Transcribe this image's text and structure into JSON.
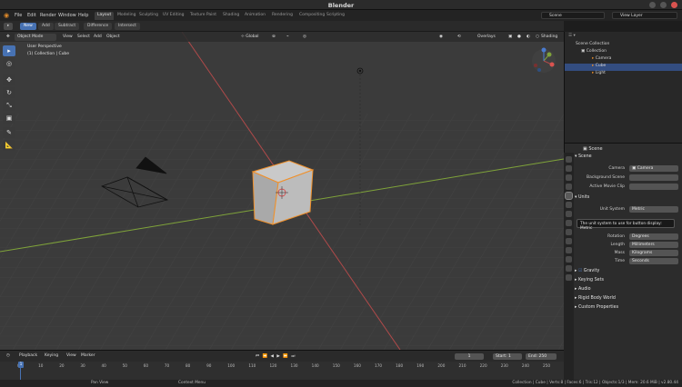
{
  "window": {
    "title": "Blender"
  },
  "menu": [
    "File",
    "Edit",
    "Render",
    "Window",
    "Help"
  ],
  "workspaces": [
    "Layout",
    "Modeling",
    "Sculpting",
    "UV Editing",
    "Texture Paint",
    "Shading",
    "Animation",
    "Rendering",
    "Compositing",
    "Scripting"
  ],
  "scene_field": "Scene",
  "view_layer_field": "View Layer",
  "tool_modes": [
    "New",
    "Add",
    "Subtract",
    "Difference",
    "Intersect"
  ],
  "viewport": {
    "mode": "Object Mode",
    "menus": [
      "View",
      "Select",
      "Add",
      "Object"
    ],
    "transform": "Global",
    "overlays": "Overlays",
    "shading": "Shading",
    "info_line1": "User Perspective",
    "info_line2": "(1) Collection | Cube"
  },
  "outliner": {
    "root": "Scene Collection",
    "collection": "Collection",
    "items": [
      "Camera",
      "Cube",
      "Light"
    ]
  },
  "properties": {
    "header": "Scene",
    "scene_panel": "Scene",
    "camera_label": "Camera",
    "camera_value": "Camera",
    "background_label": "Background Scene",
    "clip_label": "Active Movie Clip",
    "units_panel": "Units",
    "unit_system_label": "Unit System",
    "unit_system_value": "Metric",
    "tooltip": "The unit system to use for button display:  Metric",
    "rotation_label": "Rotation",
    "rotation_value": "Degrees",
    "length_label": "Length",
    "length_value": "Millimeters",
    "mass_label": "Mass",
    "mass_value": "Kilograms",
    "time_label": "Time",
    "time_value": "Seconds",
    "gravity": "Gravity",
    "keying_sets": "Keying Sets",
    "audio": "Audio",
    "rigid_body": "Rigid Body World",
    "custom_props": "Custom Properties"
  },
  "timeline": {
    "menus": [
      "Playback",
      "Keying",
      "View",
      "Marker"
    ],
    "current_frame": "1",
    "start_label": "Start:",
    "start": "1",
    "end_label": "End:",
    "end": "250",
    "frames": [
      "0",
      "10",
      "20",
      "30",
      "40",
      "50",
      "60",
      "70",
      "80",
      "90",
      "100",
      "110",
      "120",
      "130",
      "140",
      "150",
      "160",
      "170",
      "180",
      "190",
      "200",
      "210",
      "220",
      "230",
      "240",
      "250"
    ]
  },
  "status": {
    "pan": "Pan View",
    "context": "Context Menu",
    "stats": "Collection | Cube | Verts:8 | Faces:6 | Tris:12 | Objects:1/3 | Mem: 20.6 MiB | v2.80.44"
  },
  "colors": {
    "accent": "#4772b3",
    "x_axis": "#b04a4a",
    "y_axis": "#7fa33a",
    "selection": "#f0902a"
  }
}
